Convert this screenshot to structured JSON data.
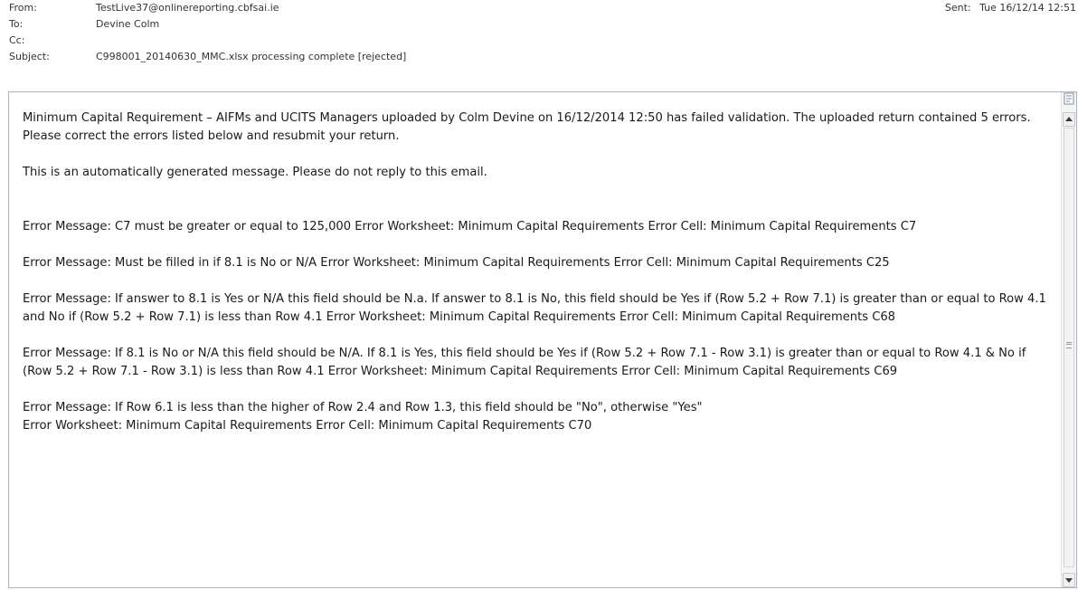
{
  "header": {
    "from_label": "From:",
    "from_value": "TestLive37@onlinereporting.cbfsai.ie",
    "to_label": "To:",
    "to_value": "Devine Colm",
    "cc_label": "Cc:",
    "cc_value": "",
    "subject_label": "Subject:",
    "subject_value": "C998001_20140630_MMC.xlsx processing complete [rejected]",
    "sent_label": "Sent:",
    "sent_value": "Tue 16/12/14 12:51"
  },
  "body": {
    "intro": "Minimum Capital Requirement – AIFMs and UCITS Managers uploaded by Colm Devine on 16/12/2014 12:50 has failed validation. The uploaded return contained 5 errors. Please correct the errors listed below and resubmit your return.",
    "notice": "This is an automatically generated message. Please do not reply to this email.",
    "errors": [
      "Error Message: C7 must be greater or equal to 125,000 Error Worksheet: Minimum Capital Requirements Error Cell: Minimum Capital Requirements C7",
      "Error Message: Must be filled in if 8.1 is No or N/A Error Worksheet: Minimum Capital Requirements Error Cell: Minimum Capital Requirements C25",
      "Error Message: If answer to 8.1 is Yes or N/A this field should be N.a. If answer to 8.1 is No, this field should be Yes if (Row 5.2 + Row 7.1) is greater than or equal to Row 4.1 and No if (Row 5.2 + Row 7.1) is less than Row 4.1 Error Worksheet: Minimum Capital Requirements Error Cell: Minimum Capital Requirements C68",
      "Error Message: If 8.1 is No or N/A this field should be N/A. If 8.1 is Yes, this field should be Yes if (Row 5.2 + Row 7.1 - Row 3.1) is greater than or equal to Row 4.1 & No if (Row 5.2 + Row 7.1 - Row 3.1) is less than Row 4.1 Error Worksheet: Minimum Capital Requirements Error Cell: Minimum Capital Requirements C69"
    ],
    "last_error_line1": "Error Message: If Row 6.1 is less than the higher of Row 2.4 and Row 1.3, this field should be \"No\", otherwise \"Yes\"",
    "last_error_line2": "Error Worksheet: Minimum Capital Requirements Error Cell: Minimum Capital Requirements C70"
  },
  "icons": {
    "scroll_top": "view-in-browser-icon",
    "scroll_up": "chevron-up-icon",
    "scroll_down": "chevron-down-icon"
  }
}
